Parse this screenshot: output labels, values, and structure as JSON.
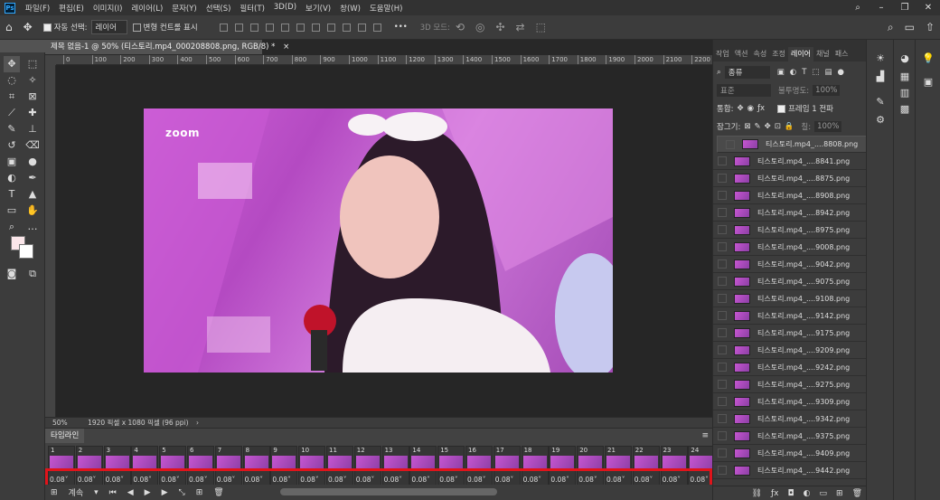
{
  "menu": [
    "파일(F)",
    "편집(E)",
    "이미지(I)",
    "레이어(L)",
    "문자(Y)",
    "선택(S)",
    "필터(T)",
    "3D(D)",
    "보기(V)",
    "창(W)",
    "도움말(H)"
  ],
  "options": {
    "auto_select_label": "자동 선택:",
    "auto_select_value": "레이어",
    "transform_controls_label": "변형 컨트롤 표시",
    "mode_3d_label": "3D 모드:",
    "more_label": "•••"
  },
  "document": {
    "tab_title": "제목 없음-1 @ 50% (티스토리.mp4_000208808.png, RGB/8) *",
    "close_label": "×",
    "ruler_ticks": [
      "0",
      "100",
      "200",
      "300",
      "400",
      "500",
      "600",
      "700",
      "800",
      "900",
      "1000",
      "1100",
      "1200",
      "1300",
      "1400",
      "1500",
      "1600",
      "1700",
      "1800",
      "1900",
      "2000",
      "2100",
      "2200"
    ],
    "zoom": "50%",
    "dimensions": "1920 픽셀 x 1080 픽셀 (96 ppi)",
    "image_logo_text": "zoom"
  },
  "timeline": {
    "tab_label": "타임라인",
    "loop_label": "계속",
    "frames": [
      {
        "num": "1",
        "delay": "0.08"
      },
      {
        "num": "2",
        "delay": "0.08"
      },
      {
        "num": "3",
        "delay": "0.08"
      },
      {
        "num": "4",
        "delay": "0.08"
      },
      {
        "num": "5",
        "delay": "0.08"
      },
      {
        "num": "6",
        "delay": "0.08"
      },
      {
        "num": "7",
        "delay": "0.08"
      },
      {
        "num": "8",
        "delay": "0.08"
      },
      {
        "num": "9",
        "delay": "0.08"
      },
      {
        "num": "10",
        "delay": "0.08"
      },
      {
        "num": "11",
        "delay": "0.08"
      },
      {
        "num": "12",
        "delay": "0.08"
      },
      {
        "num": "13",
        "delay": "0.08"
      },
      {
        "num": "14",
        "delay": "0.08"
      },
      {
        "num": "15",
        "delay": "0.08"
      },
      {
        "num": "16",
        "delay": "0.08"
      },
      {
        "num": "17",
        "delay": "0.08"
      },
      {
        "num": "18",
        "delay": "0.08"
      },
      {
        "num": "19",
        "delay": "0.08"
      },
      {
        "num": "20",
        "delay": "0.08"
      },
      {
        "num": "21",
        "delay": "0.08"
      },
      {
        "num": "22",
        "delay": "0.08"
      },
      {
        "num": "23",
        "delay": "0.08"
      },
      {
        "num": "24",
        "delay": "0.08"
      }
    ],
    "highlight_color": "#e0141b"
  },
  "layers_panel": {
    "tabs": [
      "작업",
      "액션",
      "속성",
      "조정",
      "레이어",
      "채널",
      "패스"
    ],
    "active_tab": "레이어",
    "filter_label": "종류",
    "blend_mode": "표준",
    "opacity_label": "불투명도:",
    "opacity_value": "100%",
    "unify_label": "통합:",
    "propagate_label": "프레임 1 전파",
    "lock_label": "잠그기:",
    "fill_label": "칠:",
    "fill_value": "100%",
    "layers": [
      "티스토리.mp4_....8808.png",
      "티스토리.mp4_....8841.png",
      "티스토리.mp4_....8875.png",
      "티스토리.mp4_....8908.png",
      "티스토리.mp4_....8942.png",
      "티스토리.mp4_....8975.png",
      "티스토리.mp4_....9008.png",
      "티스토리.mp4_....9042.png",
      "티스토리.mp4_....9075.png",
      "티스토리.mp4_....9108.png",
      "티스토리.mp4_....9142.png",
      "티스토리.mp4_....9175.png",
      "티스토리.mp4_....9209.png",
      "티스토리.mp4_....9242.png",
      "티스토리.mp4_....9275.png",
      "티스토리.mp4_....9309.png",
      "티스토리.mp4_....9342.png",
      "티스토리.mp4_....9375.png",
      "티스토리.mp4_....9409.png",
      "티스토리.mp4_....9442.png"
    ]
  }
}
